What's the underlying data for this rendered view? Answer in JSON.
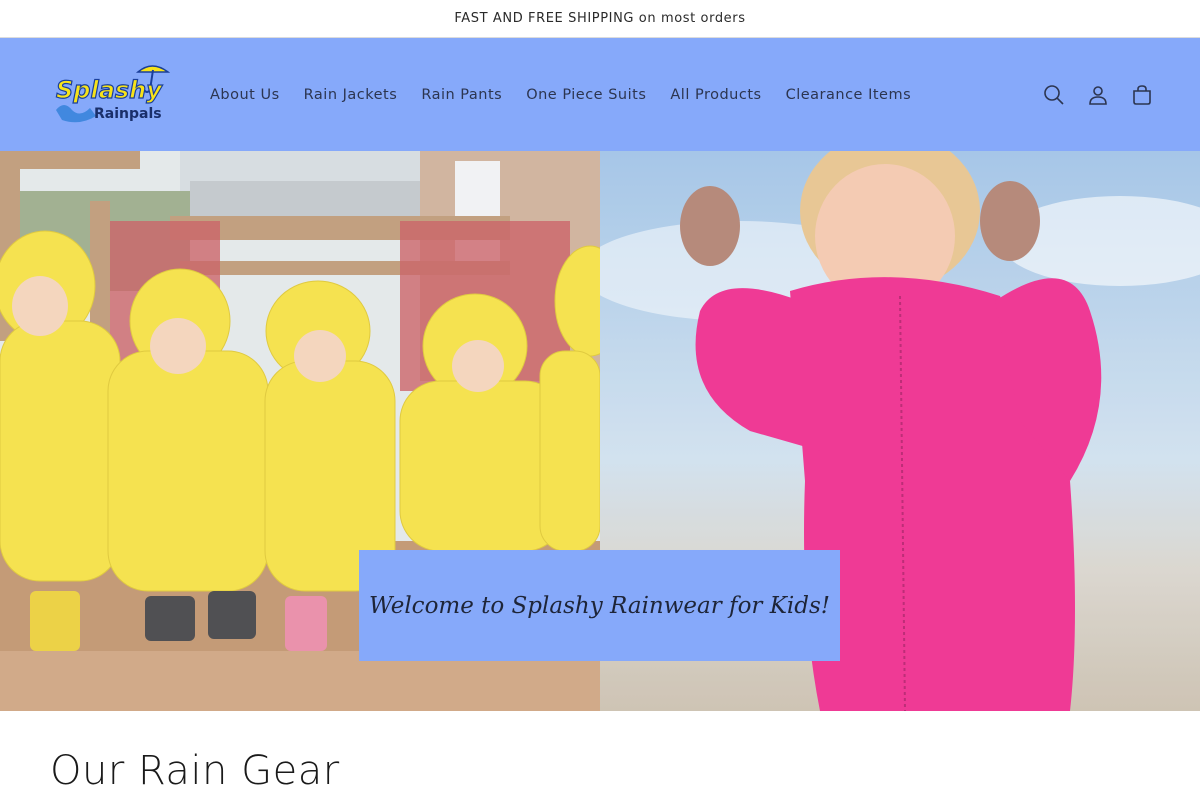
{
  "announcement": {
    "text": "FAST AND FREE SHIPPING on most orders"
  },
  "header": {
    "background": "#86a9fa",
    "logo": {
      "line1": "Splashy",
      "line2": "Rainpals"
    },
    "nav": [
      {
        "label": "About Us"
      },
      {
        "label": "Rain Jackets"
      },
      {
        "label": "Rain Pants"
      },
      {
        "label": "One Piece Suits"
      },
      {
        "label": "All Products"
      },
      {
        "label": "Clearance Items"
      }
    ],
    "icons": [
      "search-icon",
      "account-icon",
      "cart-icon"
    ]
  },
  "hero": {
    "banner_text": "Welcome to Splashy Rainwear for Kids!",
    "left_image": "children-in-yellow-rain-suits",
    "right_image": "child-in-pink-rain-suit"
  },
  "section": {
    "title": "Our Rain Gear"
  }
}
